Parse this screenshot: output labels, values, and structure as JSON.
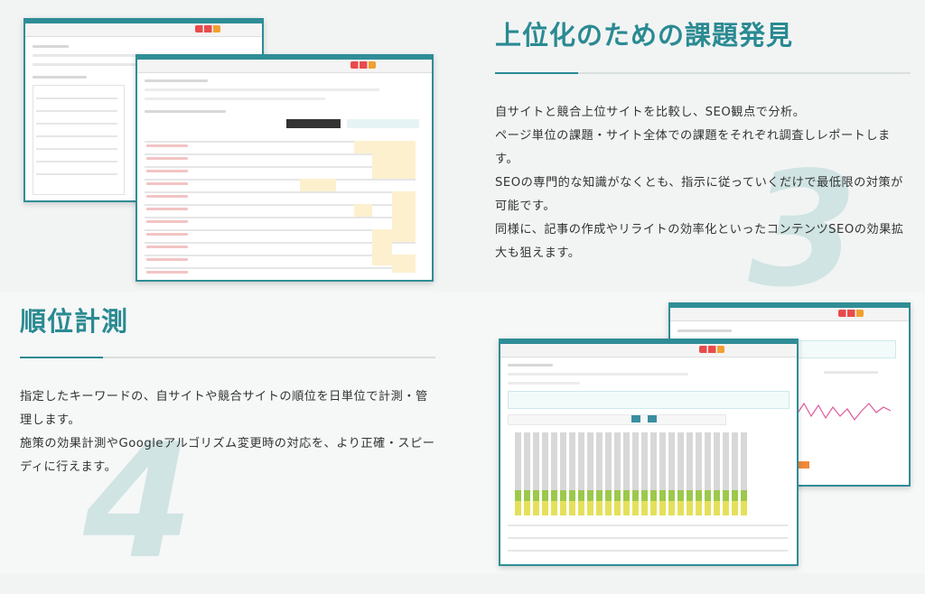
{
  "section3": {
    "number": "3",
    "heading": "上位化のための課題発見",
    "paragraphs": [
      "自サイトと競合上位サイトを比較し、SEO観点で分析。",
      "ページ単位の課題・サイト全体での課題をそれぞれ調査しレポートします。",
      "SEOの専門的な知識がなくとも、指示に従っていくだけで最低限の対策が可能です。",
      "同様に、記事の作成やリライトの効率化といったコンテンツSEOの効果拡大も狙えます。"
    ]
  },
  "section4": {
    "number": "4",
    "heading": "順位計測",
    "paragraphs": [
      "指定したキーワードの、自サイトや競合サイトの順位を日単位で計測・管理します。",
      "施策の効果計測やGoogleアルゴリズム変更時の対応を、より正確・スピーディに行えます。"
    ]
  },
  "colors": {
    "accent": "#2a8a92",
    "window_frame": "#2f8d96",
    "numeral": "#cfe4e3"
  }
}
